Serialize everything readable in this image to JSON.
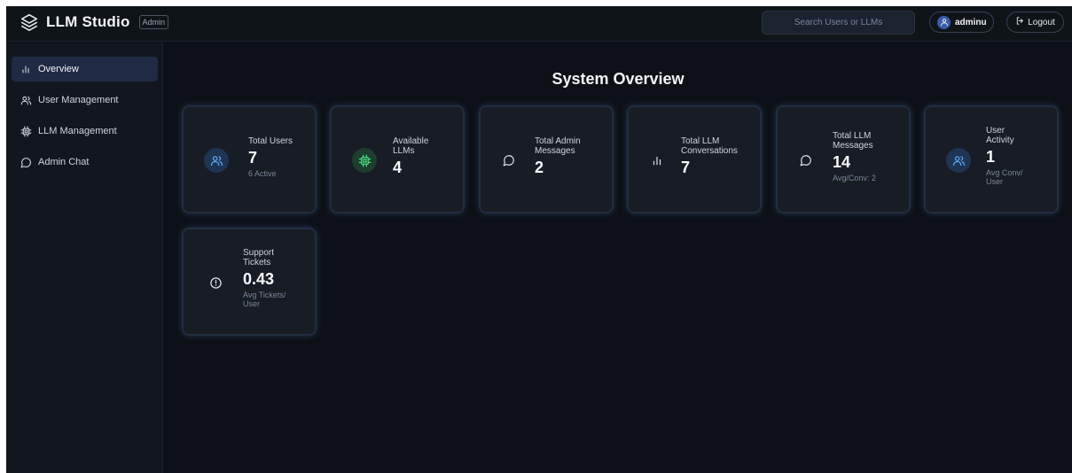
{
  "app": {
    "title": "LLM Studio",
    "badge": "Admin"
  },
  "header": {
    "search_placeholder": "Search Users or LLMs",
    "user_name": "adminu",
    "logout_label": "Logout"
  },
  "sidebar": {
    "items": [
      {
        "label": "Overview",
        "icon": "bar-chart-icon",
        "active": true
      },
      {
        "label": "User Management",
        "icon": "users-icon",
        "active": false
      },
      {
        "label": "LLM Management",
        "icon": "cpu-icon",
        "active": false
      },
      {
        "label": "Admin Chat",
        "icon": "chat-icon",
        "active": false
      }
    ]
  },
  "main": {
    "title": "System Overview",
    "cards": [
      {
        "label_lines": [
          "Total Users"
        ],
        "value": "7",
        "sub_lines": [
          "6 Active"
        ],
        "icon": "users-icon"
      },
      {
        "label_lines": [
          "Available",
          "LLMs"
        ],
        "value": "4",
        "sub_lines": [],
        "icon": "cpu-icon"
      },
      {
        "label_lines": [
          "Total Admin",
          "Messages"
        ],
        "value": "2",
        "sub_lines": [],
        "icon": "chat-icon"
      },
      {
        "label_lines": [
          "Total LLM",
          "Conversations"
        ],
        "value": "7",
        "sub_lines": [],
        "icon": "bar-chart-icon"
      },
      {
        "label_lines": [
          "Total LLM",
          "Messages"
        ],
        "value": "14",
        "sub_lines": [
          "Avg/Conv: 2"
        ],
        "icon": "chat-icon"
      },
      {
        "label_lines": [
          "User",
          "Activity"
        ],
        "value": "1",
        "sub_lines": [
          "Avg Conv/",
          "User"
        ],
        "icon": "users-icon"
      },
      {
        "label_lines": [
          "Support",
          "Tickets"
        ],
        "value": "0.43",
        "sub_lines": [
          "Avg Tickets/",
          "User"
        ],
        "icon": "alert-circle-icon"
      }
    ]
  },
  "colors": {
    "background": "#0d1117",
    "sidebar": "#12171f",
    "active_nav": "#1f2a44",
    "card": "#171c25",
    "card_glow": "#5a8ce6",
    "blue_icon": "#60a5fa",
    "green_icon": "#4ade80"
  }
}
